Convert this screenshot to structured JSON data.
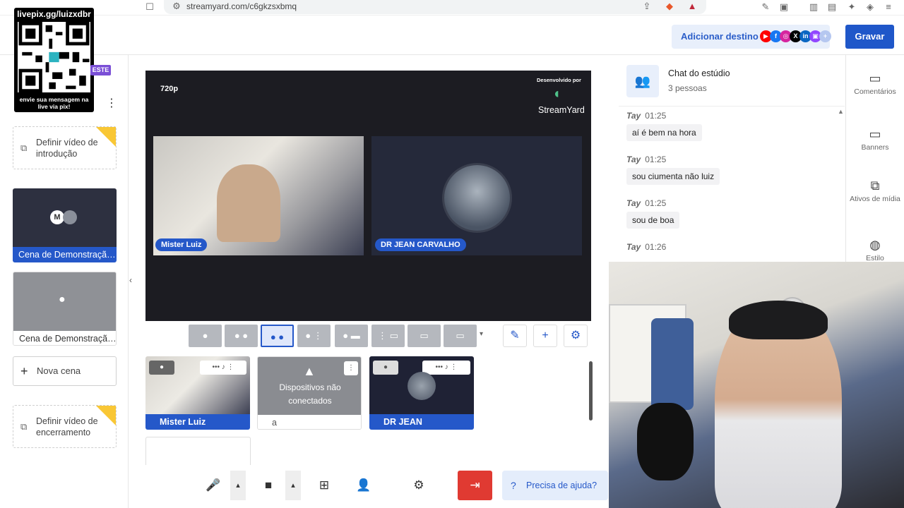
{
  "browser": {
    "url": "streamyard.com/c6gkzsxbmq"
  },
  "overlay": {
    "qr_title": "livepix.gg/luizxdbr",
    "qr_caption": "envie sua mensagem na live via pix!",
    "badge": "ESTE"
  },
  "header": {
    "add_destination": "Adicionar destino",
    "record": "Gravar",
    "social_icons": [
      "youtube",
      "facebook",
      "instagram",
      "x",
      "linkedin",
      "twitch"
    ]
  },
  "sidebar": {
    "intro_video": "Definir vídeo de introdução",
    "scenes": [
      {
        "label": "Cena de Demonstração...",
        "active": true,
        "initial": "M"
      },
      {
        "label": "Cena de Demonstração...",
        "active": false
      }
    ],
    "new_scene": "Nova cena",
    "outro_video": "Definir vídeo de encerramento"
  },
  "stage": {
    "resolution": "720p",
    "powered_by": "Desenvolvido por",
    "logo": "StreamYard",
    "participants": [
      {
        "name": "Mister Luiz"
      },
      {
        "name": "DR JEAN CARVALHO"
      }
    ]
  },
  "backstage": [
    {
      "name": "Mister Luiz",
      "status": ""
    },
    {
      "name": "a",
      "status": "Dispositivos não conectados"
    },
    {
      "name": "DR JEAN CARVALHO",
      "status": ""
    }
  ],
  "bottom": {
    "help": "Precisa de ajuda?"
  },
  "chat": {
    "title": "Chat do estúdio",
    "count": "3 pessoas",
    "messages": [
      {
        "author": "Tay",
        "time": "01:25",
        "text": "aí é bem na hora"
      },
      {
        "author": "Tay",
        "time": "01:25",
        "text": "sou ciumenta não luiz"
      },
      {
        "author": "Tay",
        "time": "01:25",
        "text": "sou de boa"
      },
      {
        "author": "Tay",
        "time": "01:26",
        "text": ""
      }
    ]
  },
  "rail": {
    "comments": "Comentários",
    "banners": "Banners",
    "media": "Ativos de mídia",
    "style": "Estilo"
  },
  "colors": {
    "accent": "#2558c9",
    "record": "#1f57c9",
    "leave": "#e03a32",
    "badge": "#7a4fd6"
  }
}
